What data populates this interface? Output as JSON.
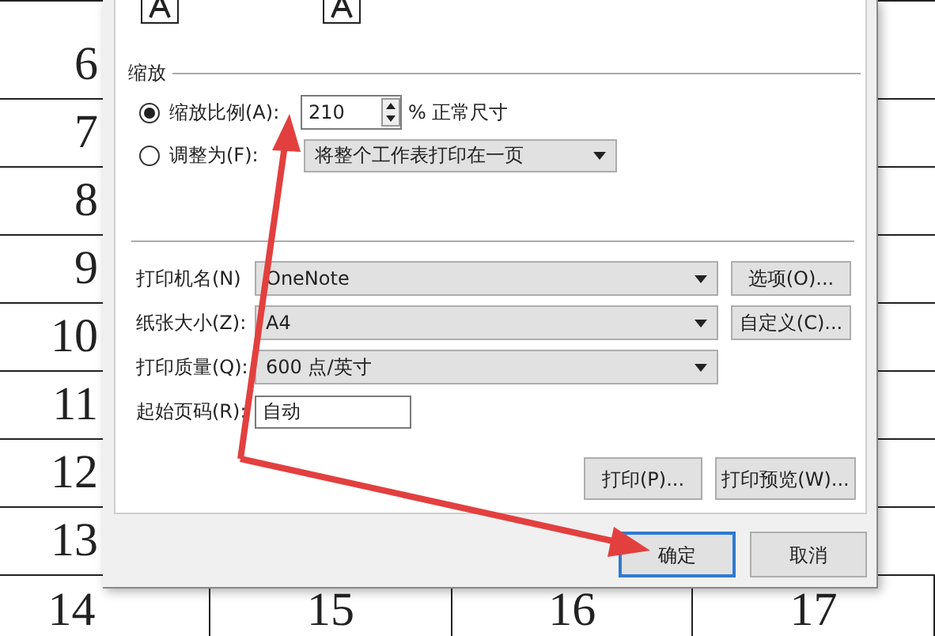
{
  "spreadsheet": {
    "row_numbers": [
      "6",
      "7",
      "8",
      "9",
      "10",
      "11",
      "12",
      "13"
    ],
    "bottom_row": [
      "14",
      "15",
      "16",
      "17"
    ]
  },
  "dialog": {
    "zoom": {
      "title": "缩放",
      "options": [
        {
          "label": "缩放比例(A):",
          "selected": true,
          "kind": "spin",
          "value": "210",
          "suffix": "% 正常尺寸"
        },
        {
          "label": "调整为(F):",
          "selected": false,
          "kind": "select",
          "value": "将整个工作表打印在一页"
        }
      ]
    },
    "printer_fields": [
      {
        "label": "打印机名(N)",
        "kind": "select",
        "value": "OneNote",
        "button": "选项(O)..."
      },
      {
        "label": "纸张大小(Z):",
        "kind": "select",
        "value": "A4",
        "button": "自定义(C)..."
      },
      {
        "label": "打印质量(Q):",
        "kind": "select",
        "value": "600 点/英寸"
      },
      {
        "label": "起始页码(R):",
        "kind": "text",
        "value": "自动"
      }
    ],
    "action_buttons": [
      "打印(P)...",
      "打印预览(W)..."
    ],
    "footer_buttons": [
      {
        "label": "确定",
        "focused": true
      },
      {
        "label": "取消",
        "focused": false
      }
    ]
  }
}
